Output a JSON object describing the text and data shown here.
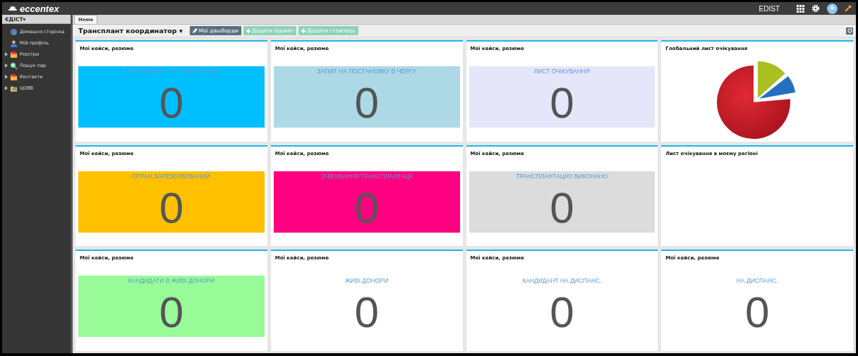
{
  "header": {
    "logo": "eccentex",
    "user": "EDIST"
  },
  "sidebar": {
    "title": "ЄДІСТ",
    "caret": "▾",
    "items": [
      {
        "label": "Домашня сторінка",
        "kind": "link"
      },
      {
        "label": "Мій профіль",
        "kind": "link"
      },
      {
        "label": "Реєстри",
        "kind": "group"
      },
      {
        "label": "Пошук пар",
        "kind": "group"
      },
      {
        "label": "Контакти",
        "kind": "group"
      },
      {
        "label": "ЦОВВ",
        "kind": "group"
      }
    ]
  },
  "tabs": [
    {
      "label": "Home",
      "selected": true
    }
  ],
  "toolbar": {
    "title": "Трансплант координатор",
    "caret": "▾",
    "buttons": [
      {
        "label": "Мої дашборди",
        "kind": "edit"
      },
      {
        "label": "Додати віджет",
        "kind": "add"
      },
      {
        "label": "Додати стовпець",
        "kind": "add"
      }
    ]
  },
  "widgets": [
    {
      "kind": "counter",
      "title": "Мої кейси, резюме",
      "label": "ОРГАНИ ДЛЯ ТРАНСПЛАНТАЦІЇ",
      "value": "0",
      "color": "#00bfff"
    },
    {
      "kind": "counter",
      "title": "Мої кейси, резюме",
      "label": "ЗАПИТ НА ПОСТАНОВКУ В ЧЕРГУ",
      "value": "0",
      "color": "#add8e6"
    },
    {
      "kind": "counter",
      "title": "Мої кейси, резюме",
      "label": "ЛИСТ ОЧІКУВАННЯ",
      "value": "0",
      "color": "#e6e6fa"
    },
    {
      "kind": "pie",
      "title": "Глобальний лист очікування"
    },
    {
      "kind": "counter",
      "title": "Мої кейси, резюме",
      "label": "ОГРАН ЗАРЕЗЕРВОВАНИЙ",
      "value": "0",
      "color": "#ffc000"
    },
    {
      "kind": "counter",
      "title": "Мої кейси, резюме",
      "label": "ОЧІКУВАННЯ ТРАНСПЛАНТАЦІЇ",
      "value": "0",
      "color": "#ff0080"
    },
    {
      "kind": "counter",
      "title": "Мої кейси, резюме",
      "label": "ТРАНСПЛАНТАЦІЮ ВИКОНАНО",
      "value": "0",
      "color": "#dcdcdc"
    },
    {
      "kind": "empty",
      "title": "Лист очікування в моєму регіоні"
    },
    {
      "kind": "counter",
      "title": "Мої кейси, резюме",
      "label": "КАНДИДАТИ В ЖИВІ ДОНОРИ",
      "value": "0",
      "color": "#98fb98"
    },
    {
      "kind": "counter",
      "title": "Мої кейси, резюме",
      "label": "ЖИВІ ДОНОРИ",
      "value": "0",
      "color": "#ffffff"
    },
    {
      "kind": "counter",
      "title": "Мої кейси, резюме",
      "label": "КАНДИДАНТ НА ДИСПАНС.",
      "value": "0",
      "color": "#ffffff"
    },
    {
      "kind": "counter",
      "title": "Мої кейси, резюме",
      "label": "НА ДИСПАНС.",
      "value": "0",
      "color": "#ffffff"
    }
  ]
}
